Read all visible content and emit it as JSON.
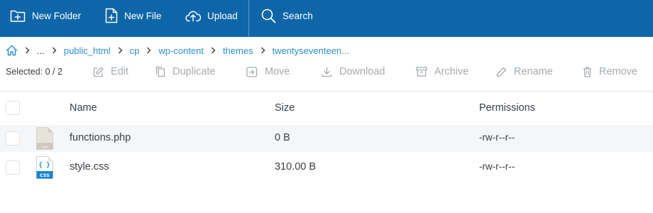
{
  "toolbar": {
    "new_folder": "New Folder",
    "new_file": "New File",
    "upload": "Upload",
    "search": "Search"
  },
  "breadcrumb": {
    "home_icon": "home-icon",
    "ellipsis": "...",
    "items": [
      "public_html",
      "cp",
      "wp-content",
      "themes",
      "twentyseventeen..."
    ]
  },
  "actions": {
    "selected_label": "Selected: 0 / 2",
    "edit": "Edit",
    "duplicate": "Duplicate",
    "move": "Move",
    "download": "Download",
    "archive": "Archive",
    "rename": "Rename",
    "remove": "Remove"
  },
  "table": {
    "columns": [
      "Name",
      "Size",
      "Permissions"
    ],
    "rows": [
      {
        "name": "functions.php",
        "size": "0 B",
        "permissions": "-rw-r--r--",
        "icon": "php-file-icon",
        "icon_text": "..."
      },
      {
        "name": "style.css",
        "size": "310.00 B",
        "permissions": "-rw-r--r--",
        "icon": "css-file-icon",
        "icon_text": "CSS",
        "icon_glyph": "{ }"
      }
    ]
  },
  "colors": {
    "toolbar_bg": "#0e66a8",
    "link": "#2a8fd4",
    "disabled_action": "#a5abb2",
    "css_badge": "#1b86d1",
    "row_highlight": "#f5f6f7"
  }
}
